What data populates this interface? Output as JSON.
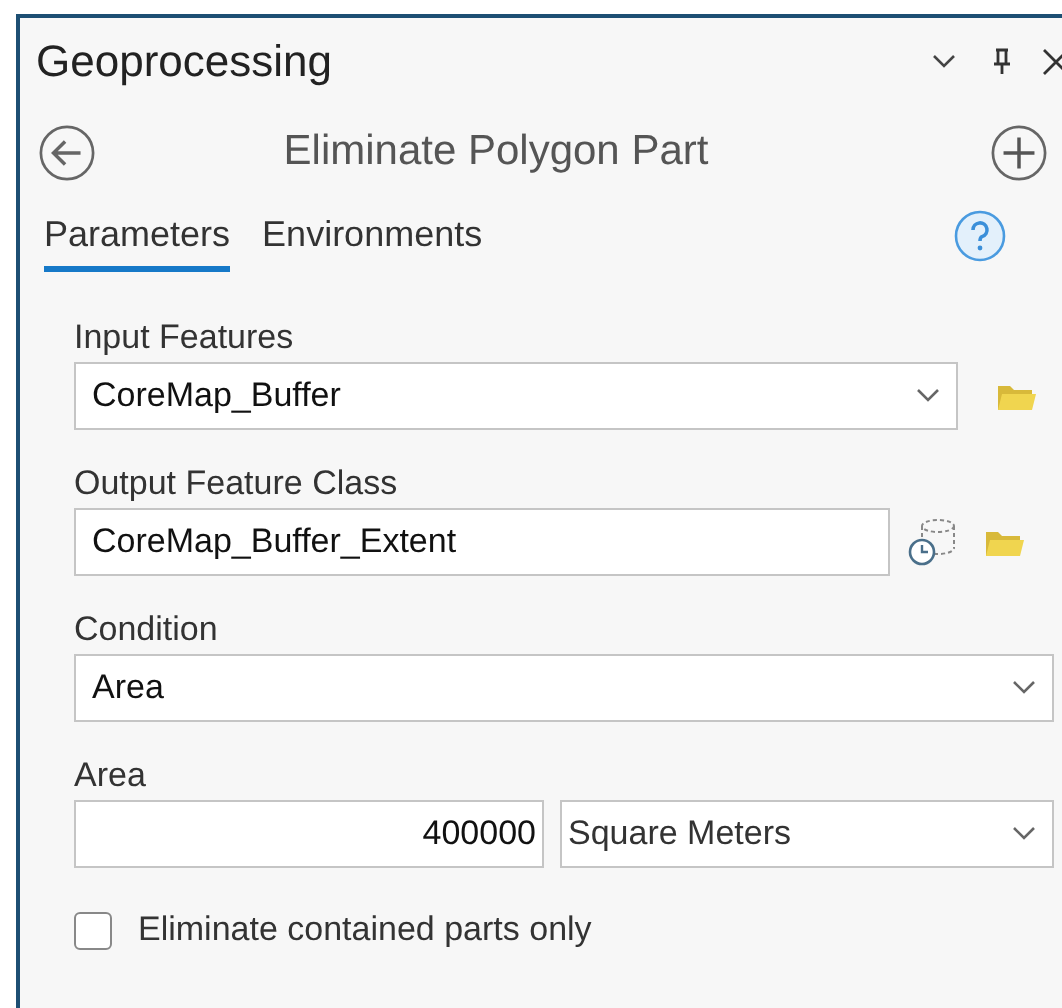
{
  "panel": {
    "title": "Geoprocessing"
  },
  "tool": {
    "title": "Eliminate Polygon Part"
  },
  "tabs": [
    {
      "label": "Parameters",
      "selected": true
    },
    {
      "label": "Environments",
      "selected": false
    }
  ],
  "parameters": [
    {
      "kind": "dropdown",
      "label": "Input Features",
      "value": "CoreMap_Buffer"
    },
    {
      "kind": "output",
      "label": "Output Feature Class",
      "value": "CoreMap_Buffer_Extent"
    },
    {
      "kind": "select",
      "label": "Condition",
      "value": "Area"
    },
    {
      "kind": "linear_unit",
      "label": "Area",
      "value": "400000",
      "unit": "Square Meters"
    },
    {
      "kind": "checkbox",
      "label": "Eliminate contained parts only",
      "checked": false
    }
  ]
}
